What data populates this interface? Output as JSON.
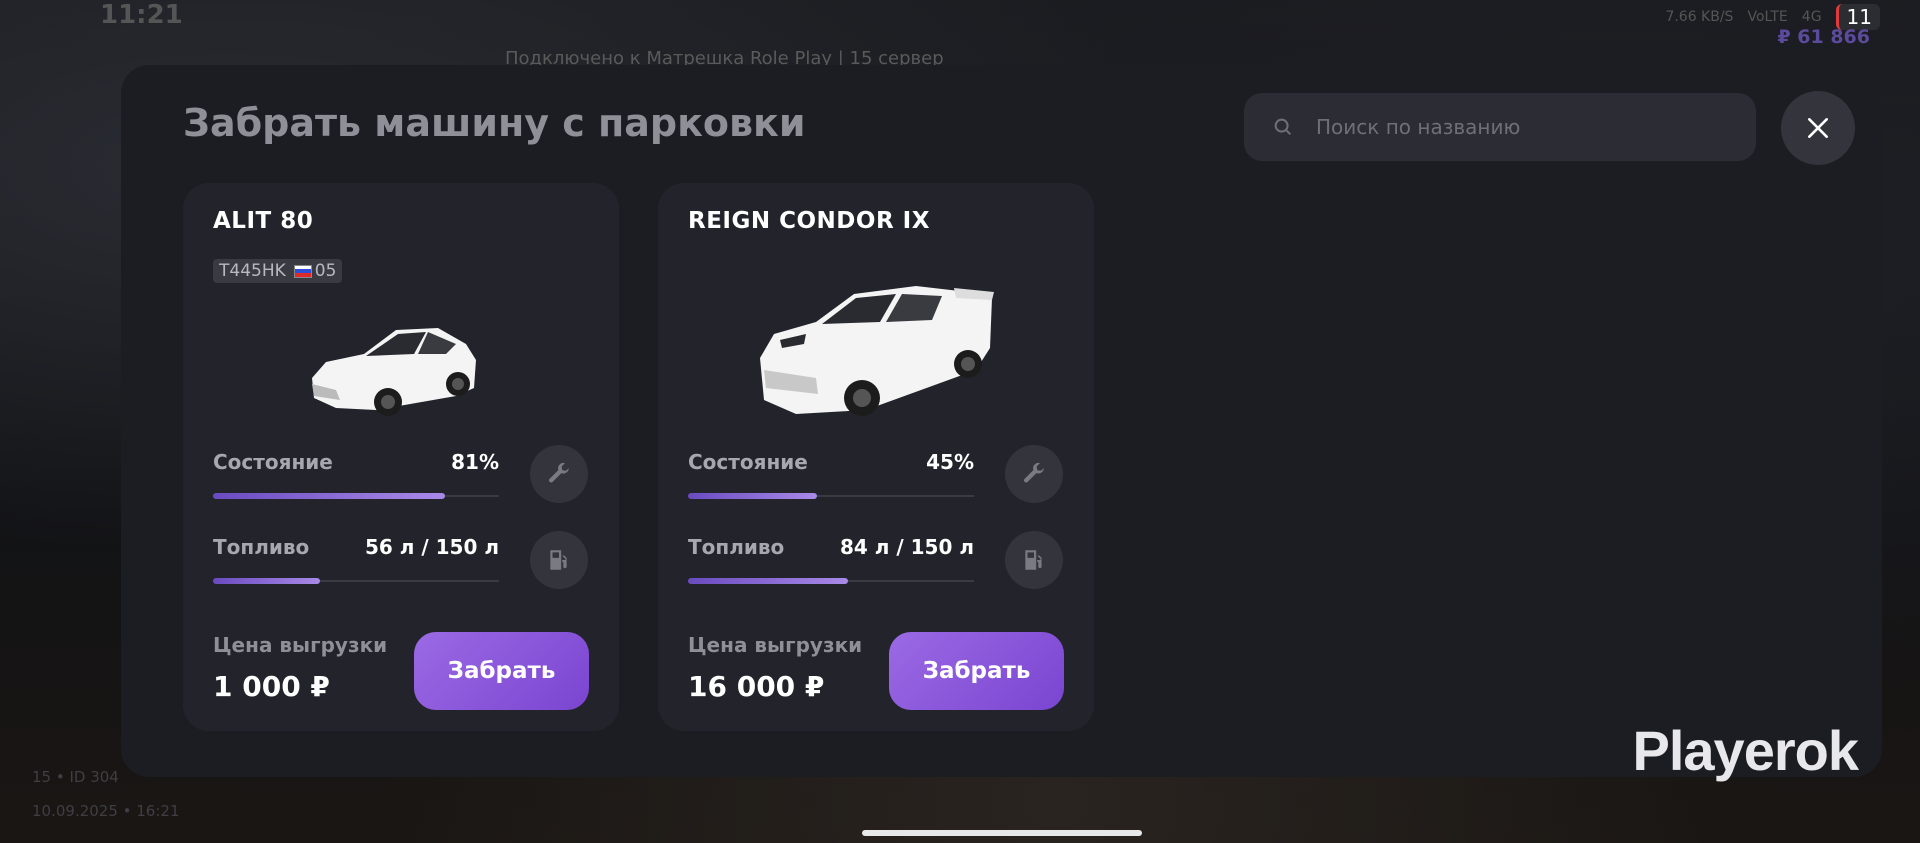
{
  "status_bar": {
    "time": "11:21",
    "net_speed": "7.66 KB/S",
    "network": "VoLTE",
    "signal": "4G",
    "notifications": "11"
  },
  "hud": {
    "server": "Подключено к Матрешка Role Play | 15 сервер",
    "money": "₽ 61 866",
    "id_line": "15 • ID 304",
    "datetime": "10.09.2025 • 16:21"
  },
  "panel": {
    "title": "Забрать машину с парковки",
    "search_placeholder": "Поиск по названию"
  },
  "cars": [
    {
      "name": "ALIT 80",
      "plate": "T445HK",
      "region": "05",
      "condition_label": "Состояние",
      "condition_value": "81%",
      "condition_pct": 81,
      "fuel_label": "Топливо",
      "fuel_value": "56 л / 150 л",
      "fuel_current": 56,
      "fuel_max": 150,
      "price_label": "Цена выгрузки",
      "price": "1 000 ₽",
      "button": "Забрать"
    },
    {
      "name": "REIGN CONDOR IX",
      "plate": "",
      "region": "",
      "condition_label": "Состояние",
      "condition_value": "45%",
      "condition_pct": 45,
      "fuel_label": "Топливо",
      "fuel_value": "84 л / 150 л",
      "fuel_current": 84,
      "fuel_max": 150,
      "price_label": "Цена выгрузки",
      "price": "16 000 ₽",
      "button": "Забрать"
    }
  ],
  "icons": {
    "search": "search-icon",
    "close": "close-icon",
    "repair": "wrench-icon",
    "fuel": "fuel-pump-icon"
  },
  "colors": {
    "accent": "#8a5ad8",
    "panel": "#1c1d23",
    "card": "#23242b"
  },
  "watermark": "Playerok"
}
